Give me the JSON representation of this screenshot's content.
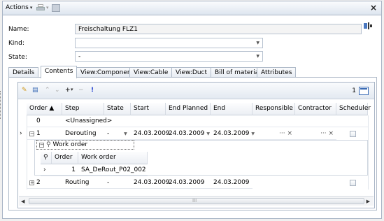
{
  "toolbar": {
    "actions_label": "Actions",
    "caret": "▾",
    "close": "×"
  },
  "form": {
    "name_label": "Name:",
    "name_value": "Freischaltung FLZ1",
    "kind_label": "Kind:",
    "kind_value": "",
    "state_label": "State:",
    "state_value": "-"
  },
  "tabs": [
    {
      "label": "Details"
    },
    {
      "label": "Contents"
    },
    {
      "label": "View:Component"
    },
    {
      "label": "View:Cable"
    },
    {
      "label": "View:Duct"
    },
    {
      "label": "Bill of material"
    },
    {
      "label": "Attributes"
    }
  ],
  "grid": {
    "record_count": "1",
    "columns": [
      "Order ▲",
      "Step",
      "State",
      "Start",
      "End Planned",
      "End",
      "Responsible",
      "Contractor",
      "Scheduler"
    ],
    "rows": [
      {
        "order": "0",
        "step": "<Unassigned>",
        "state": "",
        "start": "",
        "end_planned": "",
        "end": "",
        "responsible": "",
        "contractor": ""
      },
      {
        "order": "1",
        "step": "Derouting",
        "state": "-",
        "start": "24.03.2009",
        "end_planned": "24.03.2009",
        "end": "24.03.2009",
        "responsible": "··· ×",
        "contractor": "··· ×"
      },
      {
        "order": "2",
        "step": "Routing",
        "state": "-",
        "start": "24.03.2009",
        "end_planned": "24.03.2009",
        "end": "24.03.2009",
        "responsible": "",
        "contractor": ""
      }
    ],
    "child_band": "Work order",
    "child_columns": [
      "Order",
      "Work order"
    ],
    "child_row": {
      "order": "1",
      "work_order": "SA_DeRout_P02_002"
    }
  },
  "scroll": {
    "thumb_grip": "III"
  },
  "colors": {
    "accent": "#3a6bb5",
    "border": "#a9b5c6"
  }
}
